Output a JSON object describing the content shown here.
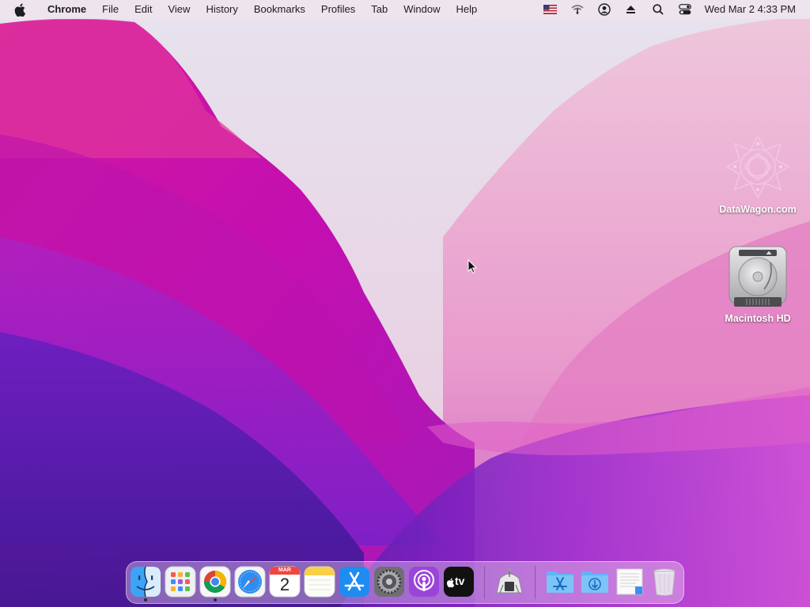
{
  "menubar": {
    "app_name": "Chrome",
    "menus": [
      "File",
      "Edit",
      "View",
      "History",
      "Bookmarks",
      "Profiles",
      "Tab",
      "Window",
      "Help"
    ],
    "status_icons": [
      "us-flag-input-icon",
      "wifi-icon",
      "user-account-icon",
      "eject-icon",
      "spotlight-search-icon",
      "control-center-icon"
    ],
    "clock": "Wed Mar 2  4:33 PM"
  },
  "desktop": {
    "icons": [
      {
        "label": "DataWagon.com"
      },
      {
        "label": "Macintosh HD"
      }
    ]
  },
  "dock": {
    "apps": [
      {
        "name": "Finder",
        "icon": "finder-icon",
        "running": true
      },
      {
        "name": "Launchpad",
        "icon": "launchpad-icon",
        "running": false
      },
      {
        "name": "Google Chrome",
        "icon": "chrome-icon",
        "running": true
      },
      {
        "name": "Safari",
        "icon": "safari-icon",
        "running": false
      },
      {
        "name": "Calendar",
        "icon": "calendar-icon",
        "running": false,
        "month": "MAR",
        "day": "2"
      },
      {
        "name": "Notes",
        "icon": "notes-icon",
        "running": false
      },
      {
        "name": "App Store",
        "icon": "app-store-icon",
        "running": false
      },
      {
        "name": "System Preferences",
        "icon": "system-preferences-icon",
        "running": false
      },
      {
        "name": "Podcasts",
        "icon": "podcasts-icon",
        "running": false
      },
      {
        "name": "TV",
        "icon": "apple-tv-icon",
        "running": false,
        "text": "tv"
      },
      {
        "name": "Automator Installer",
        "icon": "installer-icon",
        "running": false
      },
      {
        "name": "Applications",
        "icon": "applications-folder-icon",
        "running": false
      },
      {
        "name": "Downloads",
        "icon": "downloads-folder-icon",
        "running": false
      },
      {
        "name": "Document",
        "icon": "document-icon",
        "running": false
      },
      {
        "name": "Trash",
        "icon": "trash-icon",
        "running": false
      }
    ]
  }
}
